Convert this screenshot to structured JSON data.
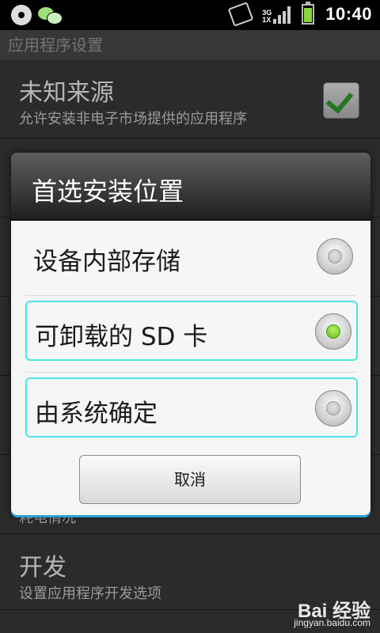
{
  "status_bar": {
    "time": "10:40",
    "network": "3G",
    "network_alt": "1X",
    "icons": [
      "disc-icon",
      "wechat-icon",
      "screen-rotate-icon",
      "signal-icon",
      "battery-icon"
    ]
  },
  "app_title": "应用程序设置",
  "background_list": {
    "items": [
      {
        "title": "未知来源",
        "subtitle": "允许安装非电子市场提供的应用程序",
        "checked": true
      },
      {
        "title": "开发",
        "subtitle": "设置应用程序开发选项"
      }
    ],
    "partial_text": "耗电情况"
  },
  "dialog": {
    "title": "首选安装位置",
    "options": [
      {
        "label": "设备内部存储",
        "selected": false
      },
      {
        "label": "可卸载的 SD 卡",
        "selected": true
      },
      {
        "label": "由系统确定",
        "selected": false
      }
    ],
    "cancel_label": "取消"
  },
  "watermark": {
    "logo": "Bai 经验",
    "url": "jingyan.baidu.com"
  },
  "colors": {
    "accent_blue": "#2aa0d6",
    "selection_cyan": "#4fe3e6",
    "radio_green": "#5fbf14",
    "check_green": "#2e9e2e"
  }
}
